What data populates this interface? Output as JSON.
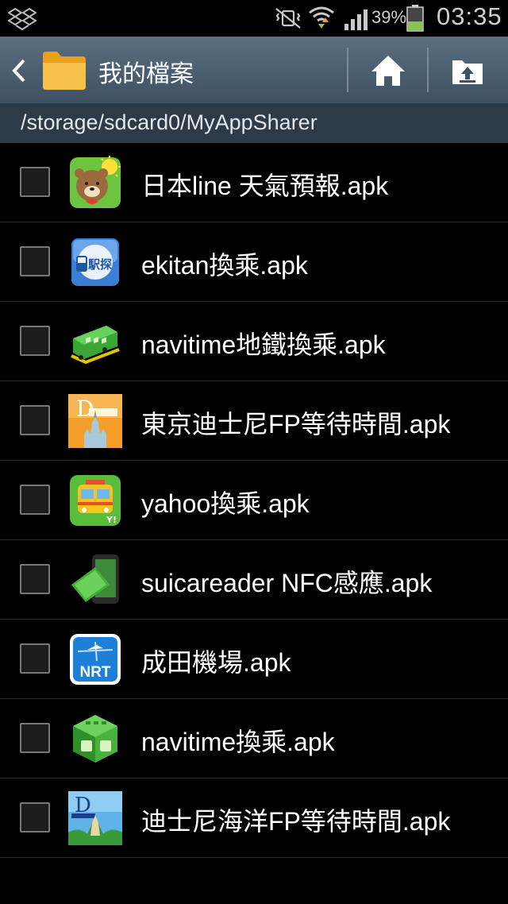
{
  "status_bar": {
    "battery_percent": "39%",
    "time": "03:35",
    "icons": [
      "dropbox-icon",
      "mute-vibrate-icon",
      "wifi-icon",
      "signal-icon",
      "battery-icon"
    ]
  },
  "action_bar": {
    "title": "我的檔案",
    "icons": [
      "back-icon",
      "folder-icon",
      "home-icon",
      "up-folder-icon"
    ]
  },
  "path": "/storage/sdcard0/MyAppSharer",
  "files": [
    {
      "name": "日本line 天氣預報.apk",
      "icon": "line-weather-app-icon"
    },
    {
      "name": "ekitan換乘.apk",
      "icon": "ekitan-app-icon"
    },
    {
      "name": "navitime地鐵換乘.apk",
      "icon": "navitime-train-app-icon"
    },
    {
      "name": "東京迪士尼FP等待時間.apk",
      "icon": "disney-fp-app-icon"
    },
    {
      "name": "yahoo換乘.apk",
      "icon": "yahoo-transit-app-icon"
    },
    {
      "name": "suicareader NFC感應.apk",
      "icon": "suicareader-app-icon"
    },
    {
      "name": "成田機場.apk",
      "icon": "narita-nrt-app-icon"
    },
    {
      "name": "navitime換乘.apk",
      "icon": "navitime-transfer-app-icon"
    },
    {
      "name": "迪士尼海洋FP等待時間.apk",
      "icon": "disneysea-fp-app-icon"
    }
  ],
  "icon_labels": {
    "ekitan": "駅探",
    "yahoo": "Y!",
    "nrt": "NRT",
    "disney_letter": "D"
  },
  "colors": {
    "action_bar_top": "#5b6f80",
    "action_bar_bottom": "#3e5062",
    "path_bar": "#2d3a47",
    "battery_fill": "#8bc34a"
  }
}
